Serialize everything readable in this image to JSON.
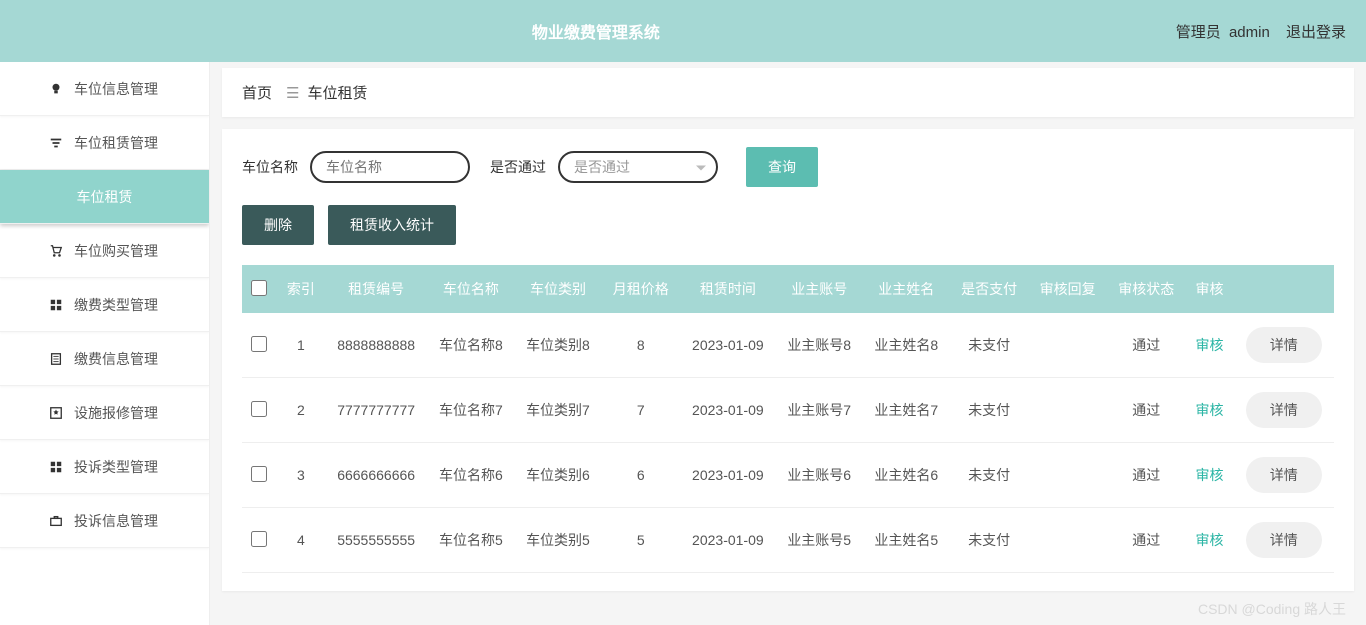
{
  "header": {
    "title": "物业缴费管理系统",
    "role": "管理员",
    "user": "admin",
    "logout": "退出登录"
  },
  "sidebar": {
    "items": [
      {
        "label": "车位信息管理",
        "icon": "bulb"
      },
      {
        "label": "车位租赁管理",
        "icon": "filter"
      },
      {
        "label": "车位租赁",
        "icon": "",
        "active": true
      },
      {
        "label": "车位购买管理",
        "icon": "cart"
      },
      {
        "label": "缴费类型管理",
        "icon": "grid"
      },
      {
        "label": "缴费信息管理",
        "icon": "doc"
      },
      {
        "label": "设施报修管理",
        "icon": "star"
      },
      {
        "label": "投诉类型管理",
        "icon": "grid"
      },
      {
        "label": "投诉信息管理",
        "icon": "briefcase"
      }
    ]
  },
  "breadcrumb": {
    "home": "首页",
    "current": "车位租赁"
  },
  "filter": {
    "nameLabel": "车位名称",
    "namePlaceholder": "车位名称",
    "passLabel": "是否通过",
    "passPlaceholder": "是否通过",
    "query": "查询"
  },
  "actions": {
    "delete": "删除",
    "stats": "租赁收入统计"
  },
  "table": {
    "headers": [
      "",
      "索引",
      "租赁编号",
      "车位名称",
      "车位类别",
      "月租价格",
      "租赁时间",
      "业主账号",
      "业主姓名",
      "是否支付",
      "审核回复",
      "审核状态",
      "审核",
      ""
    ],
    "rows": [
      {
        "idx": "1",
        "no": "8888888888",
        "name": "车位名称8",
        "cat": "车位类别8",
        "price": "8",
        "time": "2023-01-09",
        "acct": "业主账号8",
        "owner": "业主姓名8",
        "pay": "未支付",
        "reply": "",
        "status": "通过",
        "audit": "审核",
        "detail": "详情"
      },
      {
        "idx": "2",
        "no": "7777777777",
        "name": "车位名称7",
        "cat": "车位类别7",
        "price": "7",
        "time": "2023-01-09",
        "acct": "业主账号7",
        "owner": "业主姓名7",
        "pay": "未支付",
        "reply": "",
        "status": "通过",
        "audit": "审核",
        "detail": "详情"
      },
      {
        "idx": "3",
        "no": "6666666666",
        "name": "车位名称6",
        "cat": "车位类别6",
        "price": "6",
        "time": "2023-01-09",
        "acct": "业主账号6",
        "owner": "业主姓名6",
        "pay": "未支付",
        "reply": "",
        "status": "通过",
        "audit": "审核",
        "detail": "详情"
      },
      {
        "idx": "4",
        "no": "5555555555",
        "name": "车位名称5",
        "cat": "车位类别5",
        "price": "5",
        "time": "2023-01-09",
        "acct": "业主账号5",
        "owner": "业主姓名5",
        "pay": "未支付",
        "reply": "",
        "status": "通过",
        "audit": "审核",
        "detail": "详情"
      }
    ]
  },
  "watermark": "CSDN @Coding 路人王"
}
